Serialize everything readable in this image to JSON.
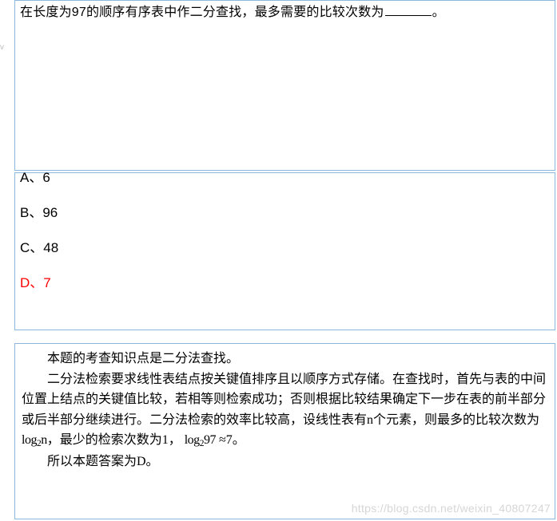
{
  "left_mark": "v",
  "question": {
    "prefix": "在长度为97的顺序有序表中作二分查找，最多需要的比较次数为",
    "suffix": "。"
  },
  "options": {
    "a": "A、6",
    "b": "B、96",
    "c": "C、48",
    "d": "D、7"
  },
  "correct_option": "d",
  "explanation": {
    "p1": "本题的考查知识点是二分法查找。",
    "p2_a": "二分法检索要求线性表结点按关键值排序且以顺序方式存储。在查找时，首先与表的中间位置上结点的关键值比较，若相等则检索成功；否则根据比较结果确定下一步在表的前半部分或后半部分继续进行。二分法检索的效率比较高，设线性表有n个元素，则最多的比较次数为",
    "log_n": "log₂n",
    "p2_b": "，最少的检索次数为1，",
    "log_97": "log₂97",
    "approx": "≈7。",
    "p3": "所以本题答案为D。"
  },
  "watermark": "https://blog.csdn.net/weixin_40807247"
}
